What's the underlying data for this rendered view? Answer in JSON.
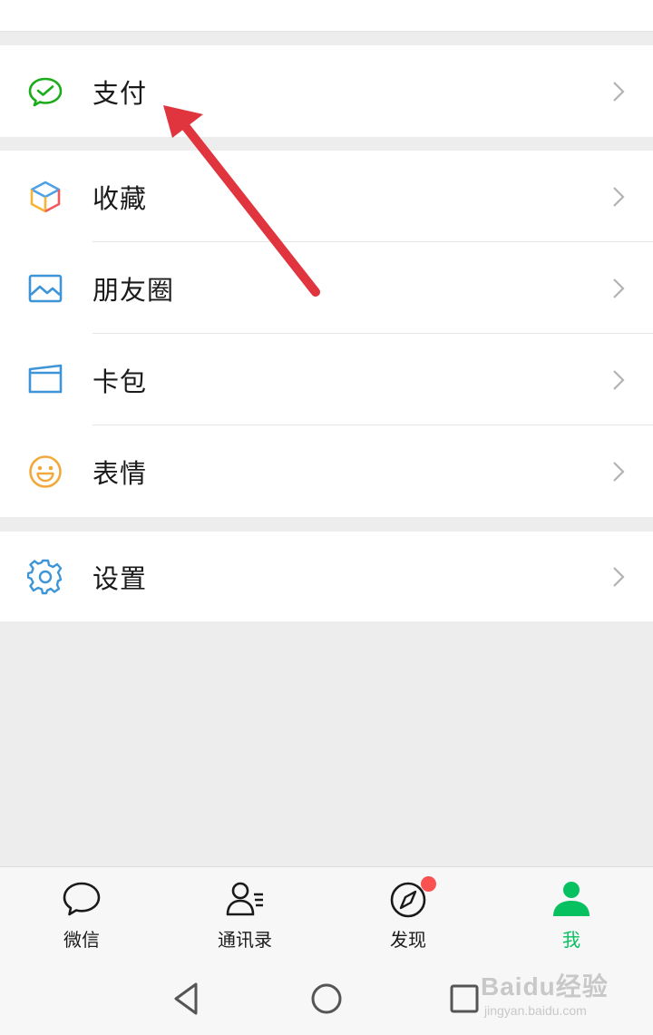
{
  "menu": {
    "pay": {
      "label": "支付",
      "icon": "wechat-pay-icon"
    },
    "group2": [
      {
        "key": "favorites",
        "label": "收藏",
        "icon": "cube-icon"
      },
      {
        "key": "moments",
        "label": "朋友圈",
        "icon": "image-icon"
      },
      {
        "key": "cards",
        "label": "卡包",
        "icon": "card-wallet-icon"
      },
      {
        "key": "stickers",
        "label": "表情",
        "icon": "smile-icon"
      }
    ],
    "settings": {
      "label": "设置",
      "icon": "gear-icon"
    }
  },
  "bottom_nav": [
    {
      "label": "微信",
      "icon": "chat-bubble-icon",
      "active": false
    },
    {
      "label": "通讯录",
      "icon": "contacts-icon",
      "active": false
    },
    {
      "label": "发现",
      "icon": "compass-icon",
      "active": false,
      "badge": true
    },
    {
      "label": "我",
      "icon": "person-icon",
      "active": true
    }
  ],
  "watermark": {
    "brand": "Baidu经验",
    "url": "jingyan.baidu.com"
  },
  "colors": {
    "accent_green": "#07c160",
    "badge_red": "#fa5151",
    "annotation_arrow": "#e0353f",
    "background": "#ededed"
  }
}
